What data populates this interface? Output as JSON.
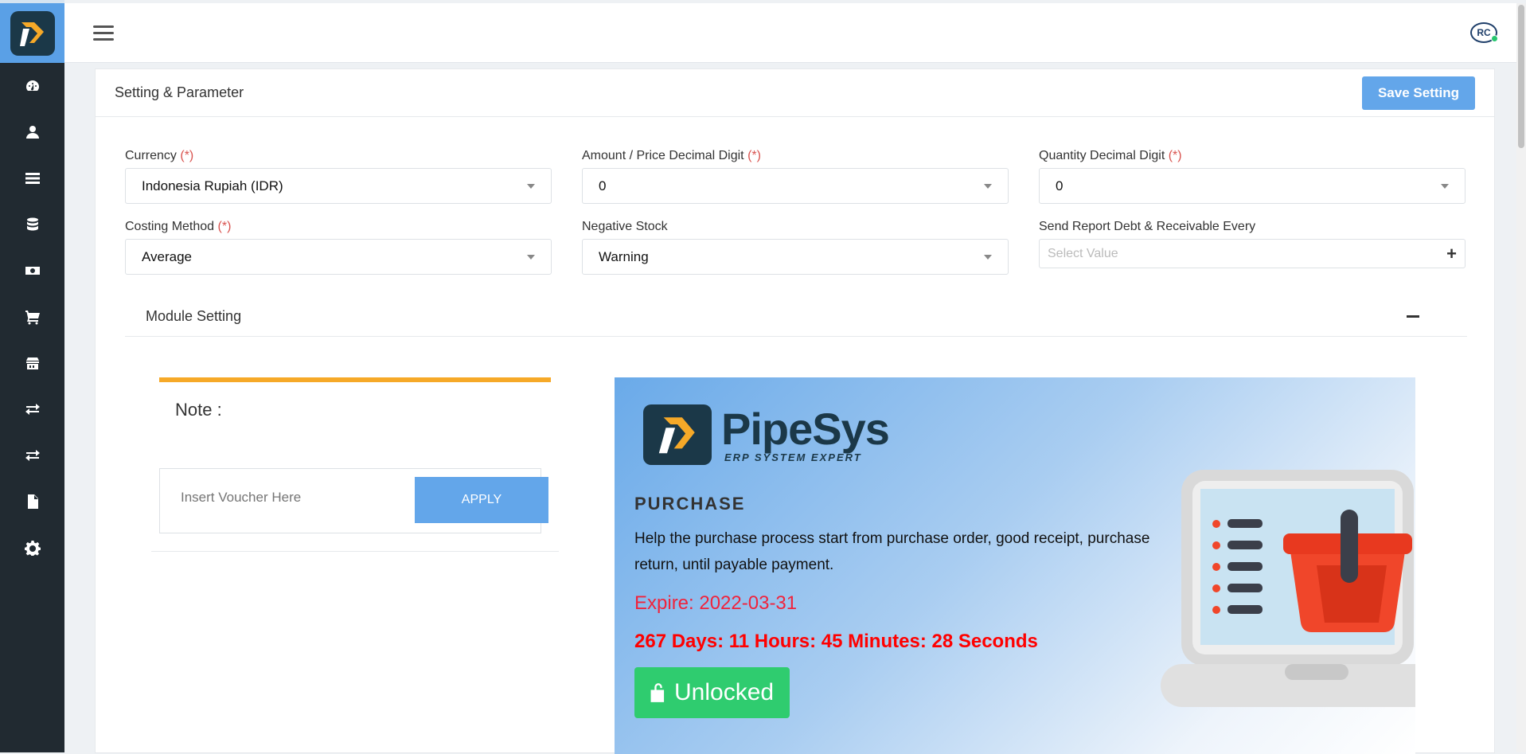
{
  "sidebar": {
    "items": [
      {
        "icon": "dashboard-icon"
      },
      {
        "icon": "user-icon"
      },
      {
        "icon": "list-icon"
      },
      {
        "icon": "database-icon"
      },
      {
        "icon": "money-icon"
      },
      {
        "icon": "cart-icon"
      },
      {
        "icon": "store-icon"
      },
      {
        "icon": "transfer-icon"
      },
      {
        "icon": "exchange-icon"
      },
      {
        "icon": "document-icon"
      },
      {
        "icon": "gear-icon"
      }
    ]
  },
  "topbar": {
    "avatar_text": "RC"
  },
  "header": {
    "title": "Setting & Parameter",
    "save_label": "Save Setting"
  },
  "form": {
    "currency_label": "Currency ",
    "currency_value": "Indonesia Rupiah (IDR)",
    "amount_label": "Amount / Price Decimal Digit ",
    "amount_value": "0",
    "quantity_label": "Quantity Decimal Digit ",
    "quantity_value": "0",
    "costing_label": "Costing Method ",
    "costing_value": "Average",
    "negative_label": "Negative Stock",
    "negative_value": "Warning",
    "report_label": "Send Report Debt & Receivable Every",
    "report_placeholder": "Select Value",
    "required_mark": "(*)"
  },
  "module": {
    "title": "Module Setting"
  },
  "note": {
    "title": "Note :",
    "voucher_placeholder": "Insert Voucher Here",
    "apply_label": "APPLY"
  },
  "promo": {
    "brand": "PipeSys",
    "tagline": "ERP SYSTEM EXPERT",
    "title": "PURCHASE",
    "description": "Help the purchase process start from purchase order, good receipt, purchase return, until payable payment.",
    "expire": "Expire: 2022-03-31",
    "countdown": "267 Days: 11 Hours: 45 Minutes: 28 Seconds",
    "unlocked_label": "Unlocked"
  },
  "colors": {
    "sidebar_bg": "#212a31",
    "brand_blue": "#5aa0e6",
    "button_blue": "#63a6ea",
    "note_accent": "#f6a928",
    "expire_red": "#f0233c",
    "unlocked_green": "#2fcc6f"
  }
}
